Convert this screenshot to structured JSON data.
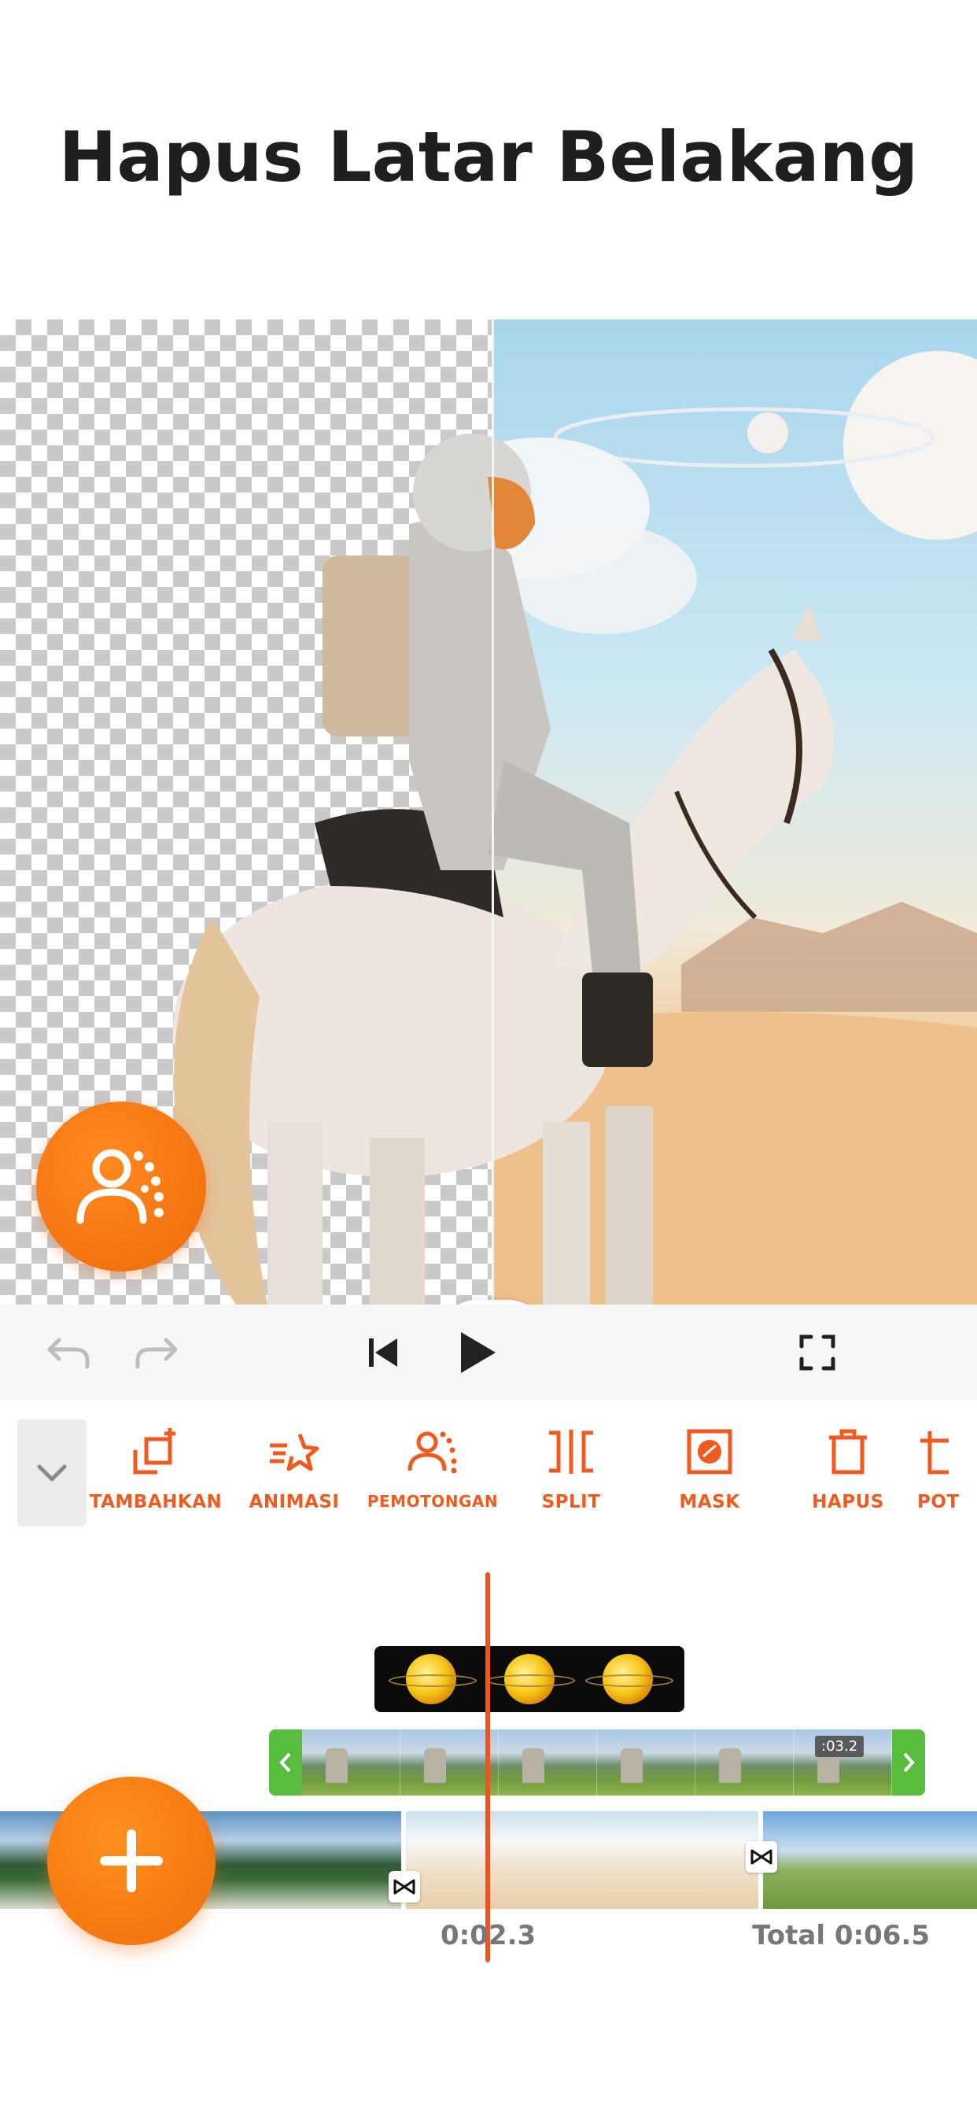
{
  "headline": "Hapus Latar Belakang",
  "preview": {
    "compare_handle_icon": "split-compare-icon",
    "remove_background_icon": "person-remove-bg-icon"
  },
  "player": {
    "undo_icon": "undo-icon",
    "redo_icon": "redo-icon",
    "skip_start_icon": "skip-to-start-icon",
    "play_icon": "play-icon",
    "fullscreen_icon": "fullscreen-icon"
  },
  "tools": [
    {
      "label": "TAMBAHKAN",
      "icon": "add-layer-icon"
    },
    {
      "label": "ANIMASI",
      "icon": "animation-star-icon"
    },
    {
      "label": "PEMOTONGAN",
      "icon": "person-cutout-icon"
    },
    {
      "label": "SPLIT",
      "icon": "split-icon"
    },
    {
      "label": "MASK",
      "icon": "mask-icon"
    },
    {
      "label": "HAPUS",
      "icon": "trash-icon"
    },
    {
      "label": "POT",
      "icon": "crop-icon"
    }
  ],
  "timeline": {
    "clip_duration": ":03.2",
    "current_time": "0:02.3",
    "total_time": "Total 0:06.5"
  },
  "colors": {
    "accent": "#f05a1f",
    "fab": "#f07a10",
    "track_green": "#58bd3c"
  }
}
